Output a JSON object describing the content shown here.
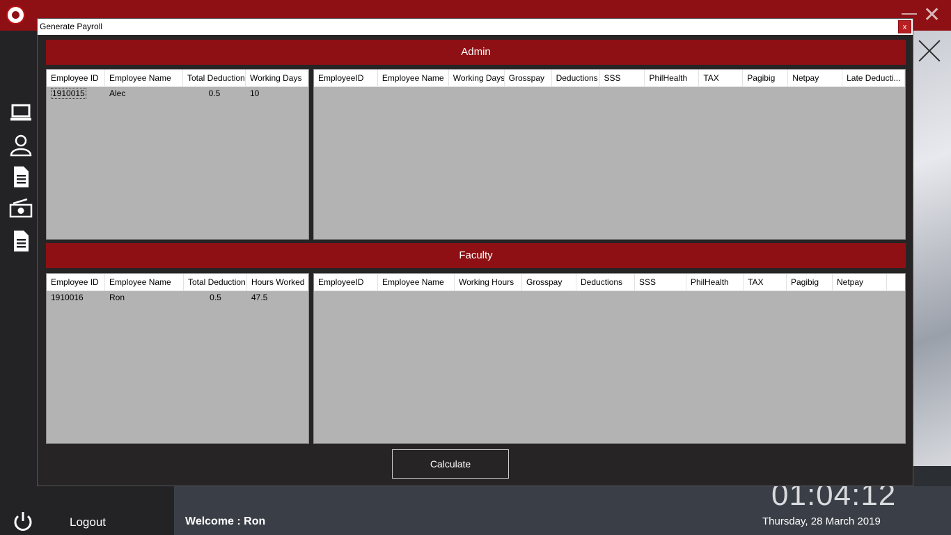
{
  "app": {
    "logo": "school-seal-logo",
    "window_controls": [
      "minimize-icon",
      "close-icon"
    ],
    "sidebar_icons": [
      "laptop-icon",
      "user-icon",
      "document-icon",
      "money-icon",
      "file-icon"
    ],
    "logout_label": "Logout",
    "welcome_text": "Welcome : Ron",
    "clock": "01:04:12",
    "date": "Thursday, 28 March 2019"
  },
  "dialog": {
    "title": "Generate Payroll",
    "close_label": "x",
    "calculate_label": "Calculate"
  },
  "admin": {
    "title": "Admin",
    "left_grid": {
      "columns": [
        "Employee ID",
        "Employee Name",
        "Total Deduction",
        "Working Days"
      ],
      "rows": [
        [
          "1910015",
          "Alec",
          "0.5",
          "10"
        ]
      ]
    },
    "right_grid": {
      "columns": [
        "EmployeeID",
        "Employee Name",
        "Working Days",
        "Grosspay",
        "Deductions",
        "SSS",
        "PhilHealth",
        "TAX",
        "Pagibig",
        "Netpay",
        "Late Deducti..."
      ],
      "rows": []
    }
  },
  "faculty": {
    "title": "Faculty",
    "left_grid": {
      "columns": [
        "Employee ID",
        "Employee Name",
        "Total Deduction",
        "Hours Worked"
      ],
      "rows": [
        [
          "1910016",
          "Ron",
          "0.5",
          "47.5"
        ]
      ]
    },
    "right_grid": {
      "columns": [
        "EmployeeID",
        "Employee Name",
        "Working Hours",
        "Grosspay",
        "Deductions",
        "SSS",
        "PhilHealth",
        "TAX",
        "Pagibig",
        "Netpay"
      ],
      "rows": []
    }
  },
  "colors": {
    "accent": "#8f1014",
    "grid_bg": "#b3b3b3",
    "dialog_bg": "#262424"
  }
}
